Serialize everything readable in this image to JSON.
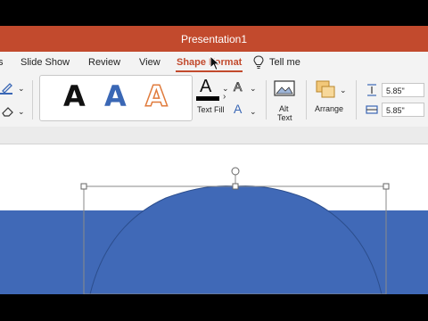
{
  "window": {
    "title": "Presentation1"
  },
  "tabs": [
    {
      "label": "s"
    },
    {
      "label": "Slide Show"
    },
    {
      "label": "Review"
    },
    {
      "label": "View"
    },
    {
      "label": "Shape Format",
      "active": true
    },
    {
      "label": "Tell me"
    }
  ],
  "ribbon": {
    "wordart_glyphs": [
      "A",
      "A",
      "A"
    ],
    "text_fill_label": "Text Fill",
    "alt_text_label_1": "Alt",
    "alt_text_label_2": "Text",
    "arrange_label": "Arrange",
    "height_value": "5.85\"",
    "width_value": "5.85\""
  },
  "colors": {
    "accent": "#c24a2d",
    "shape_fill": "#4069b7",
    "wordart_blue": "#3a67b5",
    "wordart_orange": "#e07b3c"
  }
}
